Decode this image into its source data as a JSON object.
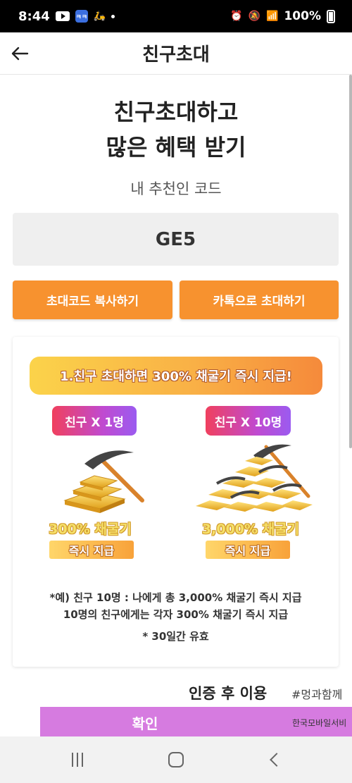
{
  "status_bar": {
    "time": "8:44",
    "app_icon_text": "ㅋㅋ",
    "battery": "100%"
  },
  "app_bar": {
    "title": "친구초대",
    "back_icon": "arrow-left-icon"
  },
  "headline": {
    "line1": "친구초대하고",
    "line2": "많은 혜택 받기"
  },
  "referral": {
    "label": "내 추천인 코드",
    "code": "GE5"
  },
  "buttons": {
    "copy_label": "초대코드 복사하기",
    "kakao_label": "카톡으로 초대하기"
  },
  "promo": {
    "title": "1.친구 초대하면 300% 채굴기 즉시 지급!",
    "tiers": [
      {
        "tag": "친구 X 1명",
        "caption": "300% 채굴기",
        "instant": "즉시 지급"
      },
      {
        "tag": "친구 X 10명",
        "caption": "3,000% 채굴기",
        "instant": "즉시 지급"
      }
    ],
    "note_line1": "*예) 친구 10명 : 나에게 총 3,000% 채굴기 즉시 지급",
    "note_line2": "10명의 친구에게는 각자 300% 채굴기 즉시 지급",
    "note_line3": "* 30일간 유효"
  },
  "bottom_banner": {
    "label": "인증 후 이용",
    "hashtag": "#멍과함께",
    "confirm_label": "확인",
    "sub_text": "한국모바일서비"
  },
  "colors": {
    "accent_orange": "#f7922f",
    "tag_gradient_start": "#f0405e",
    "tag_gradient_end": "#9b5bf0",
    "confirm_purple": "#d67be0",
    "gold": "#f5c23a"
  }
}
